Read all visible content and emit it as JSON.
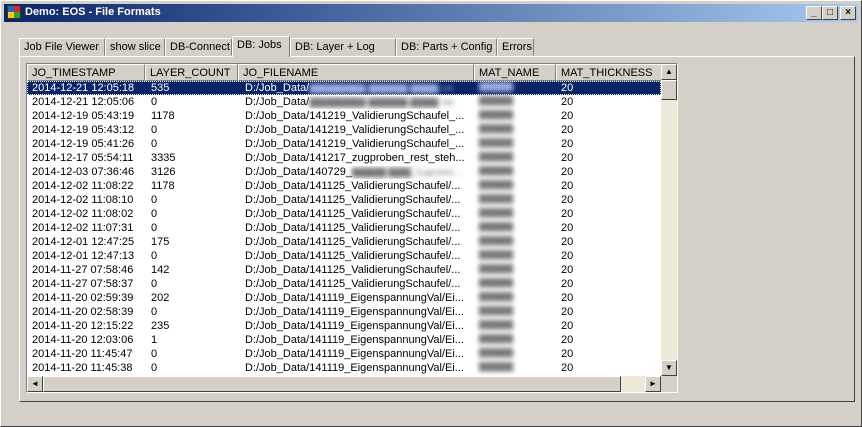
{
  "window": {
    "title": "Demo: EOS - File Formats",
    "controls": {
      "minimize": "_",
      "maximize": "□",
      "close": "×"
    }
  },
  "tabs": [
    {
      "label": "Job File Viewer",
      "active": false
    },
    {
      "label": "show slice",
      "active": false
    },
    {
      "label": "DB-Connect",
      "active": false
    },
    {
      "label": "DB: Jobs",
      "active": true
    },
    {
      "label": "DB: Layer + Log",
      "active": false
    },
    {
      "label": "DB: Parts + Config",
      "active": false
    },
    {
      "label": "Errors",
      "active": false
    }
  ],
  "grid": {
    "columns": [
      "JO_TIMESTAMP",
      "LAYER_COUNT",
      "JO_FILENAME",
      "MAT_NAME",
      "MAT_THICKNESS"
    ],
    "selected_row": 0,
    "rows": [
      [
        "2014-12-21 12:05:18",
        "535",
        "D:/Job_Data/",
        "██████████ ███████ █████.Job",
        "██████",
        "20"
      ],
      [
        "2014-12-21 12:05:06",
        "0",
        "D:/Job_Data/",
        "██████████ ███████ █████.Job",
        "██████",
        "20"
      ],
      [
        "2014-12-19 05:43:19",
        "1178",
        "D:/Job_Data/141219_ValidierungSchaufel_...",
        "",
        "██████",
        "20"
      ],
      [
        "2014-12-19 05:43:12",
        "0",
        "D:/Job_Data/141219_ValidierungSchaufel_...",
        "",
        "██████",
        "20"
      ],
      [
        "2014-12-19 05:41:26",
        "0",
        "D:/Job_Data/141219_ValidierungSchaufel_...",
        "",
        "██████",
        "20"
      ],
      [
        "2014-12-17 05:54:11",
        "3335",
        "D:/Job_Data/141217_zugproben_rest_steh...",
        "",
        "██████",
        "20"
      ],
      [
        "2014-12-03 07:36:46",
        "3126",
        "D:/Job_Data/140729_",
        "██████ ████_Zugproben...",
        "██████",
        "20"
      ],
      [
        "2014-12-02 11:08:22",
        "1178",
        "D:/Job_Data/141125_ValidierungSchaufel/...",
        "",
        "██████",
        "20"
      ],
      [
        "2014-12-02 11:08:10",
        "0",
        "D:/Job_Data/141125_ValidierungSchaufel/...",
        "",
        "██████",
        "20"
      ],
      [
        "2014-12-02 11:08:02",
        "0",
        "D:/Job_Data/141125_ValidierungSchaufel/...",
        "",
        "██████",
        "20"
      ],
      [
        "2014-12-02 11:07:31",
        "0",
        "D:/Job_Data/141125_ValidierungSchaufel/...",
        "",
        "██████",
        "20"
      ],
      [
        "2014-12-01 12:47:25",
        "175",
        "D:/Job_Data/141125_ValidierungSchaufel/...",
        "",
        "██████",
        "20"
      ],
      [
        "2014-12-01 12:47:13",
        "0",
        "D:/Job_Data/141125_ValidierungSchaufel/...",
        "",
        "██████",
        "20"
      ],
      [
        "2014-11-27 07:58:46",
        "142",
        "D:/Job_Data/141125_ValidierungSchaufel/...",
        "",
        "██████",
        "20"
      ],
      [
        "2014-11-27 07:58:37",
        "0",
        "D:/Job_Data/141125_ValidierungSchaufel/...",
        "",
        "██████",
        "20"
      ],
      [
        "2014-11-20 02:59:39",
        "202",
        "D:/Job_Data/141119_EigenspannungVal/Ei...",
        "",
        "██████",
        "20"
      ],
      [
        "2014-11-20 02:58:39",
        "0",
        "D:/Job_Data/141119_EigenspannungVal/Ei...",
        "",
        "██████",
        "20"
      ],
      [
        "2014-11-20 12:15:22",
        "235",
        "D:/Job_Data/141119_EigenspannungVal/Ei...",
        "",
        "██████",
        "20"
      ],
      [
        "2014-11-20 12:03:06",
        "1",
        "D:/Job_Data/141119_EigenspannungVal/Ei...",
        "",
        "██████",
        "20"
      ],
      [
        "2014-11-20 11:45:47",
        "0",
        "D:/Job_Data/141119_EigenspannungVal/Ei...",
        "",
        "██████",
        "20"
      ],
      [
        "2014-11-20 11:45:38",
        "0",
        "D:/Job_Data/141119_EigenspannungVal/Ei...",
        "",
        "██████",
        "20"
      ]
    ]
  },
  "scrollbars": {
    "up": "▲",
    "down": "▼",
    "left": "◄",
    "right": "►"
  },
  "colors": {
    "face": "#d4d0c8",
    "selection": "#0a246a",
    "title_start": "#0a246a",
    "title_end": "#a6caf0"
  }
}
